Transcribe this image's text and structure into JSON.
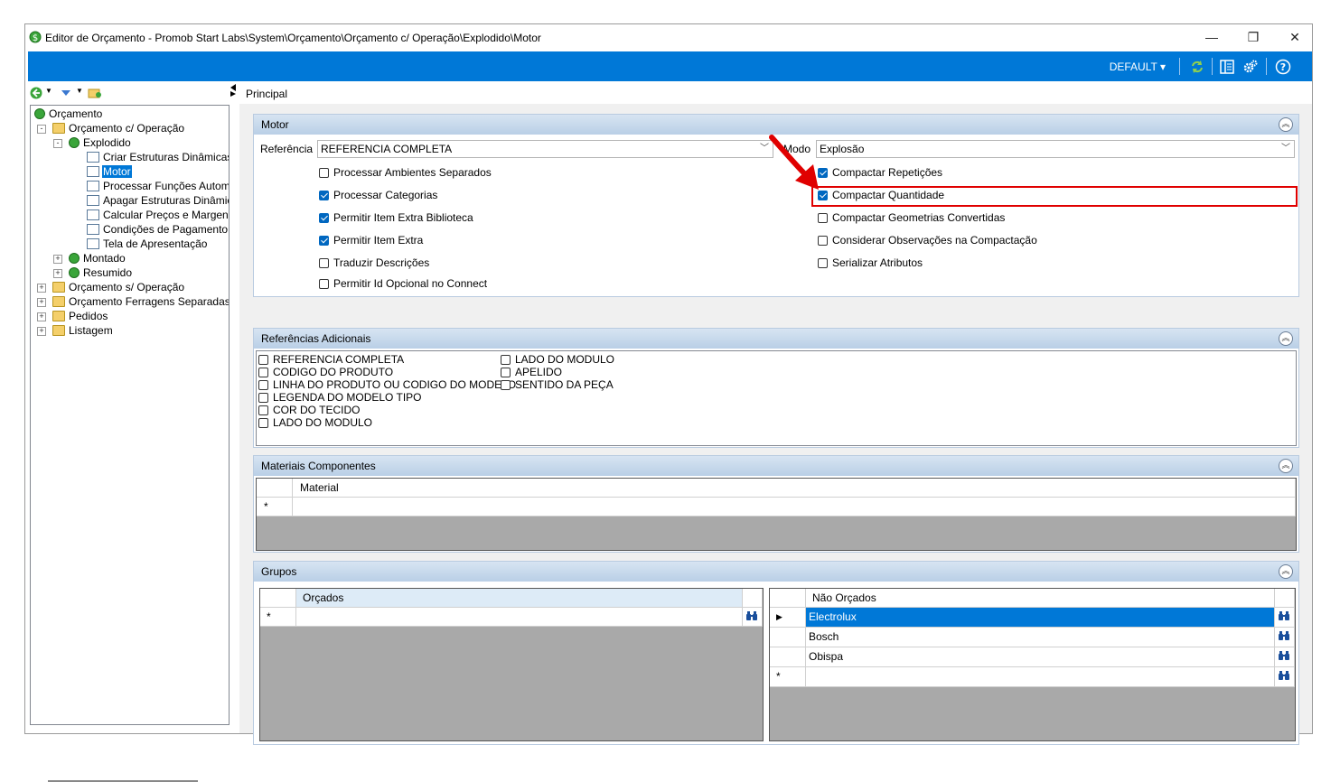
{
  "window": {
    "title": "Editor de Orçamento - Promob Start Labs\\System\\Orçamento\\Orçamento c/ Operação\\Explodido\\Motor",
    "controls": {
      "minimize": "—",
      "restore": "❐",
      "close": "✕"
    }
  },
  "toolbar": {
    "profile": "DEFAULT",
    "profile_arrow": "▾",
    "icons": [
      "refresh-icon",
      "layout-icon",
      "settings-icon",
      "help-icon"
    ],
    "accent": "#0078d7"
  },
  "tree": {
    "nodes": [
      {
        "label": "Orçamento",
        "icon": "money-icon"
      },
      {
        "label": "Orçamento c/ Operação",
        "icon": "folder-icon"
      },
      {
        "label": "Explodido",
        "icon": "money-icon"
      },
      {
        "label": "Criar Estruturas Dinâmicas",
        "icon": "script-icon"
      },
      {
        "label": "Motor",
        "icon": "script-icon",
        "selected": true
      },
      {
        "label": "Processar Funções Automá",
        "icon": "script-icon"
      },
      {
        "label": "Apagar Estruturas Dinâmica",
        "icon": "script-icon"
      },
      {
        "label": "Calcular Preços e Margens",
        "icon": "script-icon"
      },
      {
        "label": "Condições de Pagamento",
        "icon": "script-icon"
      },
      {
        "label": "Tela de Apresentação",
        "icon": "script-icon"
      },
      {
        "label": "Montado",
        "icon": "money-icon"
      },
      {
        "label": "Resumido",
        "icon": "money-icon"
      },
      {
        "label": "Orçamento s/ Operação",
        "icon": "folder-icon"
      },
      {
        "label": "Orçamento Ferragens Separadas",
        "icon": "folder-icon"
      },
      {
        "label": "Pedidos",
        "icon": "folder-icon"
      },
      {
        "label": "Listagem",
        "icon": "folder-icon"
      }
    ]
  },
  "tab": {
    "label": "Principal"
  },
  "motor": {
    "title": "Motor",
    "referencia_label": "Referência",
    "referencia_value": "REFERENCIA COMPLETA",
    "modo_label": "Modo",
    "modo_value": "Explosão",
    "left_checks": [
      {
        "label": "Processar Ambientes Separados",
        "checked": false
      },
      {
        "label": "Processar Categorias",
        "checked": true
      },
      {
        "label": "Permitir Item Extra Biblioteca",
        "checked": true
      },
      {
        "label": "Permitir Item Extra",
        "checked": true
      },
      {
        "label": "Traduzir Descrições",
        "checked": false
      },
      {
        "label": "Permitir Id Opcional no Connect",
        "checked": false
      }
    ],
    "right_checks": [
      {
        "label": "Compactar Repetições",
        "checked": true
      },
      {
        "label": "Compactar Quantidade",
        "checked": true
      },
      {
        "label": "Compactar Geometrias Convertidas",
        "checked": false
      },
      {
        "label": "Considerar Observações na Compactação",
        "checked": false
      },
      {
        "label": "Serializar Atributos",
        "checked": false
      }
    ]
  },
  "referencias": {
    "title": "Referências Adicionais",
    "col1": [
      "REFERENCIA COMPLETA",
      "CODIGO DO PRODUTO",
      "LINHA DO PRODUTO OU CODIGO DO MODELO",
      "LEGENDA DO MODELO TIPO",
      "COR DO TECIDO",
      "LADO DO MODULO"
    ],
    "col2": [
      "LADO DO MODULO",
      "APELIDO",
      "SENTIDO DA PEÇA"
    ]
  },
  "materiais": {
    "title": "Materiais Componentes",
    "column": "Material",
    "new_row_marker": "*"
  },
  "grupos": {
    "title": "Grupos",
    "orcados": {
      "column": "Orçados",
      "new_row_marker": "*"
    },
    "nao_orcados": {
      "column": "Não Orçados",
      "rows": [
        "Electrolux",
        "Bosch",
        "Obispa"
      ],
      "current_row_marker": "▶",
      "new_row_marker": "*"
    }
  }
}
